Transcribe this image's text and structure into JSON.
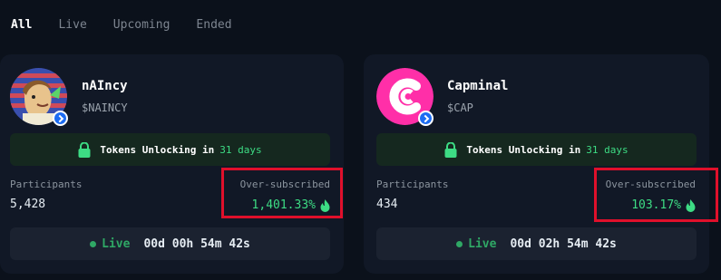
{
  "tabs": [
    {
      "label": "All",
      "active": true
    },
    {
      "label": "Live",
      "active": false
    },
    {
      "label": "Upcoming",
      "active": false
    },
    {
      "label": "Ended",
      "active": false
    }
  ],
  "colors": {
    "background": "#0b111b",
    "card": "#111826",
    "accent_green": "#3ddc84",
    "highlight_red": "#e0102b",
    "capminal_pink": "#ff2fa8"
  },
  "cards": [
    {
      "name": "nAIncy",
      "ticker": "$NAINCY",
      "avatar_icon": "cartoon-character-avatar",
      "unlock": {
        "prefix": "Tokens Unlocking in",
        "days": "31 days"
      },
      "participants_label": "Participants",
      "participants_value": "5,428",
      "oversubscribed_label": "Over-subscribed",
      "oversubscribed_value": "1,401.33%",
      "status": "Live",
      "countdown": "00d 00h 54m 42s"
    },
    {
      "name": "Capminal",
      "ticker": "$CAP",
      "avatar_icon": "capminal-logo",
      "unlock": {
        "prefix": "Tokens Unlocking in",
        "days": "31 days"
      },
      "participants_label": "Participants",
      "participants_value": "434",
      "oversubscribed_label": "Over-subscribed",
      "oversubscribed_value": "103.17%",
      "status": "Live",
      "countdown": "00d 02h 54m 42s"
    }
  ]
}
